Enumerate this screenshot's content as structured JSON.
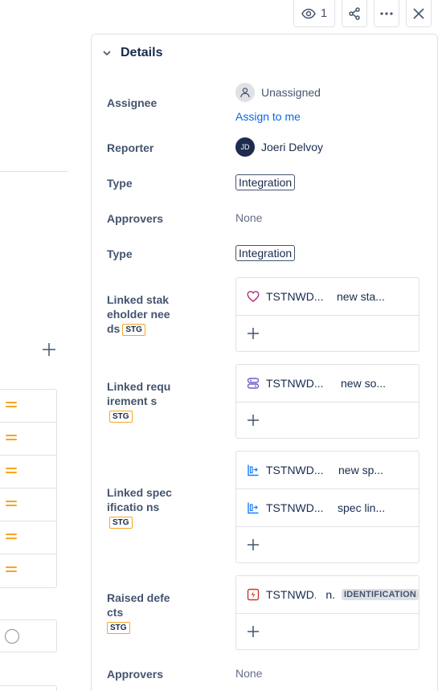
{
  "toolbar": {
    "watch_count": "1"
  },
  "details": {
    "title": "Details",
    "assignee": {
      "label": "Assignee",
      "value": "Unassigned",
      "assign_link": "Assign to me"
    },
    "reporter": {
      "label": "Reporter",
      "initials": "JD",
      "name": "Joeri Delvoy"
    },
    "type1": {
      "label": "Type",
      "value": "Integration"
    },
    "approvers1": {
      "label": "Approvers",
      "value": "None"
    },
    "type2": {
      "label": "Type",
      "value": "Integration"
    },
    "stakeholder": {
      "label": "Linked stakeholder needs",
      "stg": "STG",
      "items": [
        {
          "key": "TSTNWD...",
          "summary": "new sta...",
          "icon": "heart-icon"
        }
      ]
    },
    "requirements": {
      "label": "Linked requirement s",
      "stg": "STG",
      "items": [
        {
          "key": "TSTNWD...",
          "summary": "new so...",
          "icon": "requirement-icon"
        }
      ]
    },
    "specifications": {
      "label": "Linked specificatio ns",
      "stg": "STG",
      "items": [
        {
          "key": "TSTNWD...",
          "summary": "new sp...",
          "icon": "specification-icon"
        },
        {
          "key": "TSTNWD...",
          "summary": "spec lin...",
          "icon": "specification-icon"
        }
      ]
    },
    "defects": {
      "label": "Raised defects",
      "stg": "STG",
      "items": [
        {
          "key": "TSTNWD...",
          "summary": "n.",
          "badge": "IDENTIFICATION",
          "icon": "defect-icon"
        }
      ]
    },
    "approvers2": {
      "label": "Approvers",
      "value": "None"
    }
  },
  "colors": {
    "accent_link": "#0c66e4",
    "stg_border": "#f5a623",
    "priority_medium": "#f5a623",
    "defect": "#c9372c",
    "spec": "#1d7afc",
    "stakeholder": "#ae2e7f"
  }
}
